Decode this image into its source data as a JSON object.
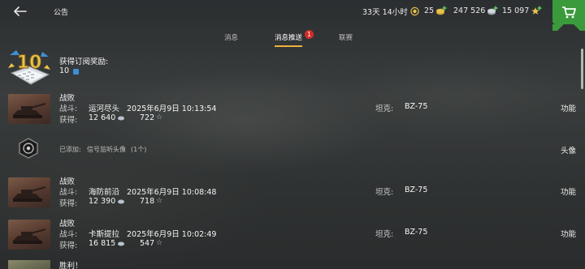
{
  "header": {
    "title": "公告",
    "premium_time": "33天 14小时",
    "gold": "25",
    "credits": "247 526",
    "free_xp": "15 097"
  },
  "tabs": [
    {
      "label": "消息"
    },
    {
      "label": "消息推送",
      "badge": "1"
    },
    {
      "label": "联赛"
    }
  ],
  "subscription": {
    "title": "获得订阅奖励:",
    "amount": "10",
    "emblem_number": "10"
  },
  "battle_rows": [
    {
      "result": "战败",
      "battle_label": "战斗:",
      "map": "运河尽头",
      "datetime": "2025年6月9日 10:13:54",
      "earned_label": "获得:",
      "credits": "12 640",
      "xp": "722",
      "tank_label": "坦克:",
      "tank": "BZ-75",
      "action": "功能"
    },
    {
      "result": "战败",
      "battle_label": "战斗:",
      "map": "海防前沿",
      "datetime": "2025年6月9日 10:08:48",
      "earned_label": "获得:",
      "credits": "12 390",
      "xp": "718",
      "tank_label": "坦克:",
      "tank": "BZ-75",
      "action": "功能"
    },
    {
      "result": "战败",
      "battle_label": "战斗:",
      "map": "卡斯提拉",
      "datetime": "2025年6月9日 10:02:49",
      "earned_label": "获得:",
      "credits": "16 815",
      "xp": "547",
      "tank_label": "坦克:",
      "tank": "BZ-75",
      "action": "功能"
    }
  ],
  "avatar_row": {
    "label": "已添加:",
    "text": "信号监听头像",
    "count": "(1个)",
    "action": "头像"
  },
  "partial_row": {
    "result": "胜利！"
  },
  "icons": {
    "back": "arrow-left-icon",
    "premium": "premium-laurel-icon",
    "gold": "gold-icon",
    "credits": "credits-icon",
    "free_xp": "free-xp-star-icon",
    "cart": "shopping-cart-icon",
    "credit_small": "credit-coin-icon",
    "xp_small": "xp-star-icon"
  },
  "colors": {
    "accent": "#f0b03a",
    "badge": "#d62a2a",
    "shop": "#3b9a3b",
    "gold": "#e8c24a",
    "star": "#e8c24a"
  }
}
